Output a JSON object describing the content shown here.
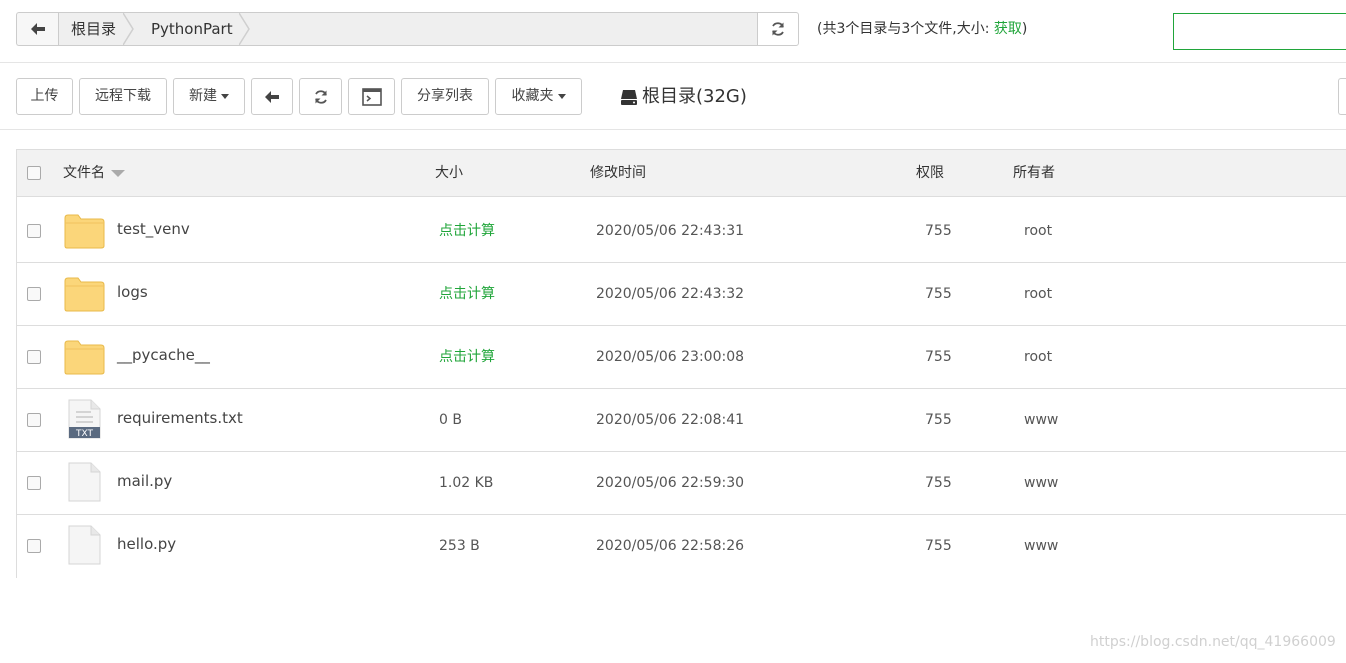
{
  "path": {
    "crumbs": [
      "根目录",
      "PythonPart"
    ],
    "summary_text": "(共3个目录与3个文件,大小: ",
    "summary_link": "获取",
    "summary_end": ")"
  },
  "toolbar": {
    "upload": "上传",
    "remote_download": "远程下载",
    "new": "新建",
    "share_list": "分享列表",
    "favorites": "收藏夹",
    "disk_label": "根目录(32G)"
  },
  "table": {
    "headers": {
      "name": "文件名",
      "size": "大小",
      "mtime": "修改时间",
      "perm": "权限",
      "owner": "所有者"
    },
    "rows": [
      {
        "type": "folder",
        "name": "test_venv",
        "size": "点击计算",
        "mtime": "2020/05/06 22:43:31",
        "perm": "755",
        "owner": "root"
      },
      {
        "type": "folder",
        "name": "logs",
        "size": "点击计算",
        "mtime": "2020/05/06 22:43:32",
        "perm": "755",
        "owner": "root"
      },
      {
        "type": "folder",
        "name": "__pycache__",
        "size": "点击计算",
        "mtime": "2020/05/06 23:00:08",
        "perm": "755",
        "owner": "root"
      },
      {
        "type": "txt",
        "name": "requirements.txt",
        "size": "0 B",
        "mtime": "2020/05/06 22:08:41",
        "perm": "755",
        "owner": "www"
      },
      {
        "type": "file",
        "name": "mail.py",
        "size": "1.02 KB",
        "mtime": "2020/05/06 22:59:30",
        "perm": "755",
        "owner": "www"
      },
      {
        "type": "file",
        "name": "hello.py",
        "size": "253 B",
        "mtime": "2020/05/06 22:58:26",
        "perm": "755",
        "owner": "www"
      }
    ]
  },
  "icons": {
    "txt_badge": "TXT",
    "folder": "folder-icon",
    "file": "file-icon",
    "txt": "txt-file-icon"
  },
  "watermark": "https://blog.csdn.net/qq_41966009",
  "colors": {
    "accent": "#20a53a",
    "folder": "#fbd67a",
    "folder_border": "#e8b94a"
  }
}
